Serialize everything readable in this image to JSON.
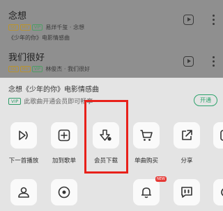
{
  "songs": [
    {
      "title": "念想",
      "tags": [
        "SQ",
        "MV",
        "VIP"
      ],
      "artist": "易烊千玺 · 念想",
      "subtitle": "《少年的你》电影情感曲"
    },
    {
      "title": "我们很好",
      "tags": [
        "SQ",
        "MV",
        "VIP"
      ],
      "artist": "林俊杰 · 我们很好",
      "subtitle": ""
    }
  ],
  "sheet": {
    "title": "念想《少年的你》电影情感曲",
    "vip_badge": "VIP",
    "vip_text": "此歌曲开通会员即可畅享",
    "open_button": "开通"
  },
  "actions": [
    {
      "label": "下一首播放",
      "icon": "play-next-icon"
    },
    {
      "label": "加到歌单",
      "icon": "add-to-playlist-icon"
    },
    {
      "label": "会员下载",
      "icon": "vip-download-icon"
    },
    {
      "label": "单曲购买",
      "icon": "cart-icon"
    },
    {
      "label": "分享",
      "icon": "share-icon"
    },
    {
      "label": "",
      "icon": "partial-icon"
    }
  ],
  "actions_row2": [
    {
      "icon": "user-icon"
    },
    {
      "icon": "disc-icon"
    },
    {
      "icon": "bell-icon",
      "badge": "NEW"
    },
    {
      "icon": "quote-icon"
    },
    {
      "icon": "partial-icon"
    }
  ],
  "colors": {
    "accent_green": "#2ca36b",
    "highlight_red": "#e8211a"
  }
}
